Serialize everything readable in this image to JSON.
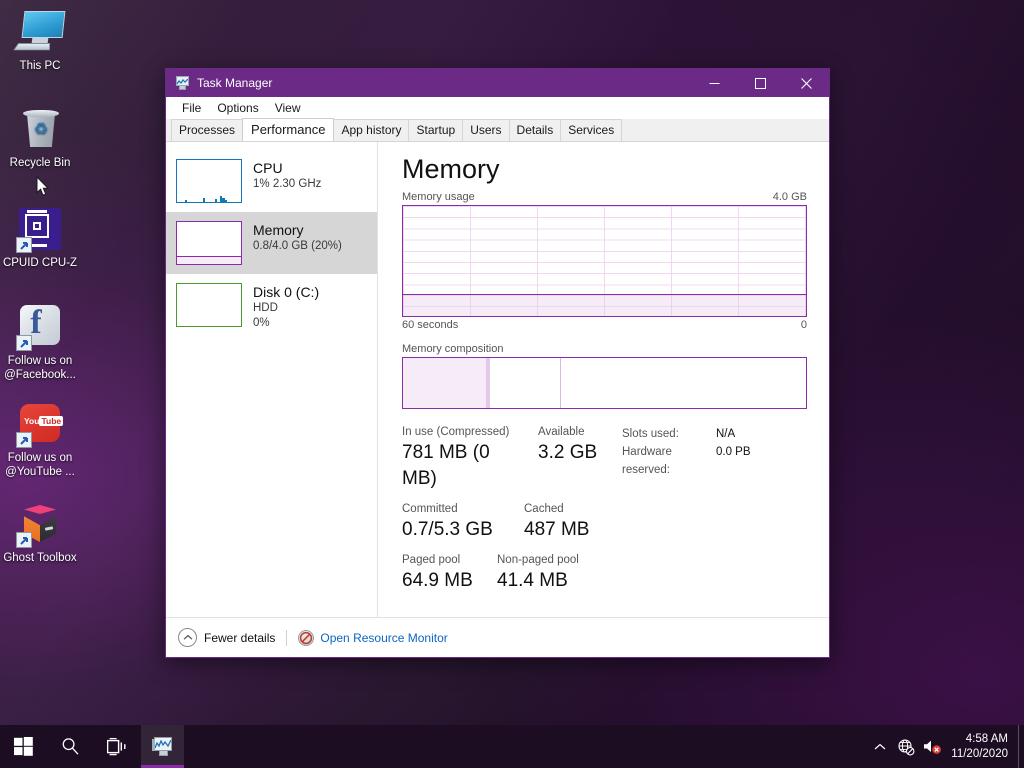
{
  "desktop": {
    "icons": [
      {
        "label": "This PC",
        "icon": "this-pc-icon",
        "shortcut": false
      },
      {
        "label": "Recycle Bin",
        "icon": "recycle-bin-icon",
        "shortcut": false
      },
      {
        "label": "CPUID CPU-Z",
        "icon": "cpu-z-icon",
        "shortcut": true
      },
      {
        "label": "Follow us on @Facebook...",
        "icon": "facebook-icon",
        "shortcut": true
      },
      {
        "label": "Follow us on @YouTube ...",
        "icon": "youtube-icon",
        "shortcut": true
      },
      {
        "label": "Ghost Toolbox",
        "icon": "ghost-toolbox-icon",
        "shortcut": true
      }
    ]
  },
  "window": {
    "title": "Task Manager",
    "icon": "task-manager-icon",
    "controls": {
      "minimize": "minimize-icon",
      "maximize": "maximize-icon",
      "close": "close-icon"
    }
  },
  "menu": {
    "items": [
      "File",
      "Options",
      "View"
    ]
  },
  "tabs": {
    "items": [
      {
        "label": "Processes",
        "active": false
      },
      {
        "label": "Performance",
        "active": true
      },
      {
        "label": "App history",
        "active": false
      },
      {
        "label": "Startup",
        "active": false
      },
      {
        "label": "Users",
        "active": false
      },
      {
        "label": "Details",
        "active": false
      },
      {
        "label": "Services",
        "active": false
      }
    ]
  },
  "sidebar": {
    "items": [
      {
        "name": "CPU",
        "line1": "1%  2.30 GHz",
        "line2": "",
        "color": "#1477ba",
        "selected": false,
        "usage_percent": 1
      },
      {
        "name": "Memory",
        "line1": "0.8/4.0 GB (20%)",
        "line2": "",
        "color": "#8b2ba8",
        "selected": true,
        "usage_percent": 20
      },
      {
        "name": "Disk 0 (C:)",
        "line1": "HDD",
        "line2": "0%",
        "color": "#4c9a2a",
        "selected": false,
        "usage_percent": 0
      }
    ]
  },
  "main": {
    "title": "Memory",
    "graph": {
      "label": "Memory usage",
      "max_label": "4.0 GB",
      "time_label": "60 seconds",
      "zero_label": "0",
      "accent_color": "#8b2ba8"
    },
    "composition": {
      "label": "Memory composition",
      "segments": [
        {
          "name": "in-use",
          "percent": 20.5,
          "fill": "#f5ecf7"
        },
        {
          "name": "modified",
          "percent": 1.2,
          "fill": "#e4c9ec"
        },
        {
          "name": "standby",
          "percent": 17.5,
          "fill": "#ffffff"
        },
        {
          "name": "free",
          "percent": 60.8,
          "fill": "#ffffff"
        }
      ]
    },
    "stats": {
      "row1": [
        {
          "label": "In use (Compressed)",
          "value": "781 MB (0 MB)"
        },
        {
          "label": "Available",
          "value": "3.2 GB"
        }
      ],
      "row2": [
        {
          "label": "Committed",
          "value": "0.7/5.3 GB"
        },
        {
          "label": "Cached",
          "value": "487 MB"
        }
      ],
      "row3": [
        {
          "label": "Paged pool",
          "value": "64.9 MB"
        },
        {
          "label": "Non-paged pool",
          "value": "41.4 MB"
        }
      ],
      "right": [
        {
          "key": "Slots used:",
          "value": "N/A"
        },
        {
          "key": "Hardware reserved:",
          "value": "0.0 PB"
        }
      ]
    }
  },
  "footer": {
    "fewer_details": "Fewer details",
    "open_resource_monitor": "Open Resource Monitor"
  },
  "taskbar": {
    "start": "windows-start-icon",
    "search": "search-icon",
    "task_view": "task-view-icon",
    "apps": [
      {
        "name": "task-manager-taskbar-icon",
        "active": true
      }
    ],
    "tray": {
      "chevron": "chevron-up-icon",
      "network": "network-no-internet-icon",
      "volume": "volume-muted-icon"
    },
    "clock": {
      "time": "4:58 AM",
      "date": "11/20/2020"
    }
  },
  "chart_data": {
    "type": "area",
    "title": "Memory usage",
    "xlabel": "60 seconds",
    "ylabel": "Memory",
    "ylim": [
      0,
      4.0
    ],
    "y_unit": "GB",
    "x": [
      0,
      60
    ],
    "series": [
      {
        "name": "Memory in use",
        "values": [
          0.8,
          0.8
        ]
      }
    ],
    "grid": true,
    "legend": "none",
    "annotations": [
      "4.0 GB",
      "60 seconds",
      "0"
    ]
  }
}
